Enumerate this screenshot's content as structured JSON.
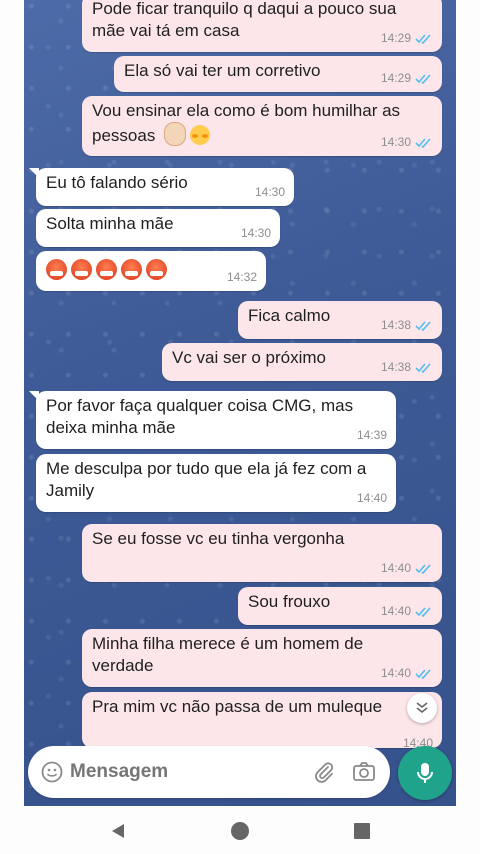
{
  "messages": [
    {
      "dir": "out",
      "text": "Pode ficar tranquilo q daqui a pouco sua mãe vai tá em casa",
      "time": "14:29"
    },
    {
      "dir": "out",
      "text": "Ela só vai ter um corretivo",
      "time": "14:29"
    },
    {
      "dir": "out",
      "text": "Vou ensinar ela como é bom humilhar as pessoas",
      "time": "14:30"
    },
    {
      "dir": "in",
      "text": "Eu tô falando sério",
      "time": "14:30"
    },
    {
      "dir": "in",
      "text": "Solta minha mãe",
      "time": "14:30"
    },
    {
      "dir": "in",
      "text": "",
      "emoji": "angry-face-x5",
      "time": "14:32"
    },
    {
      "dir": "out",
      "text": "Fica calmo",
      "time": "14:38"
    },
    {
      "dir": "out",
      "text": "Vc vai ser o próximo",
      "time": "14:38"
    },
    {
      "dir": "in",
      "text": "Por favor faça qualquer coisa CMG, mas deixa minha mãe",
      "time": "14:39"
    },
    {
      "dir": "in",
      "text": "Me desculpa por tudo que ela já fez com a Jamily",
      "time": "14:40"
    },
    {
      "dir": "out",
      "text": "Se eu fosse vc eu tinha vergonha",
      "time": "14:40"
    },
    {
      "dir": "out",
      "text": "Sou frouxo",
      "time": "14:40"
    },
    {
      "dir": "out",
      "text": "Minha filha merece é um homem de verdade",
      "time": "14:40"
    },
    {
      "dir": "out",
      "text": "Pra mim vc não passa de um muleque",
      "time": "14:40"
    }
  ],
  "composer": {
    "placeholder": "Mensagem",
    "icons": [
      "emoji-icon",
      "attach-icon",
      "camera-icon",
      "mic-icon"
    ]
  },
  "colors": {
    "outgoing_bubble": "#fde6ea",
    "incoming_bubble": "#ffffff",
    "read_ticks": "#53bdeb",
    "mic_button": "#1fa38a",
    "chat_background": "#41609b"
  },
  "icons": {
    "scroll_down": "chevron-double-down-icon",
    "nav": [
      "back-icon",
      "home-icon",
      "recents-icon"
    ]
  }
}
